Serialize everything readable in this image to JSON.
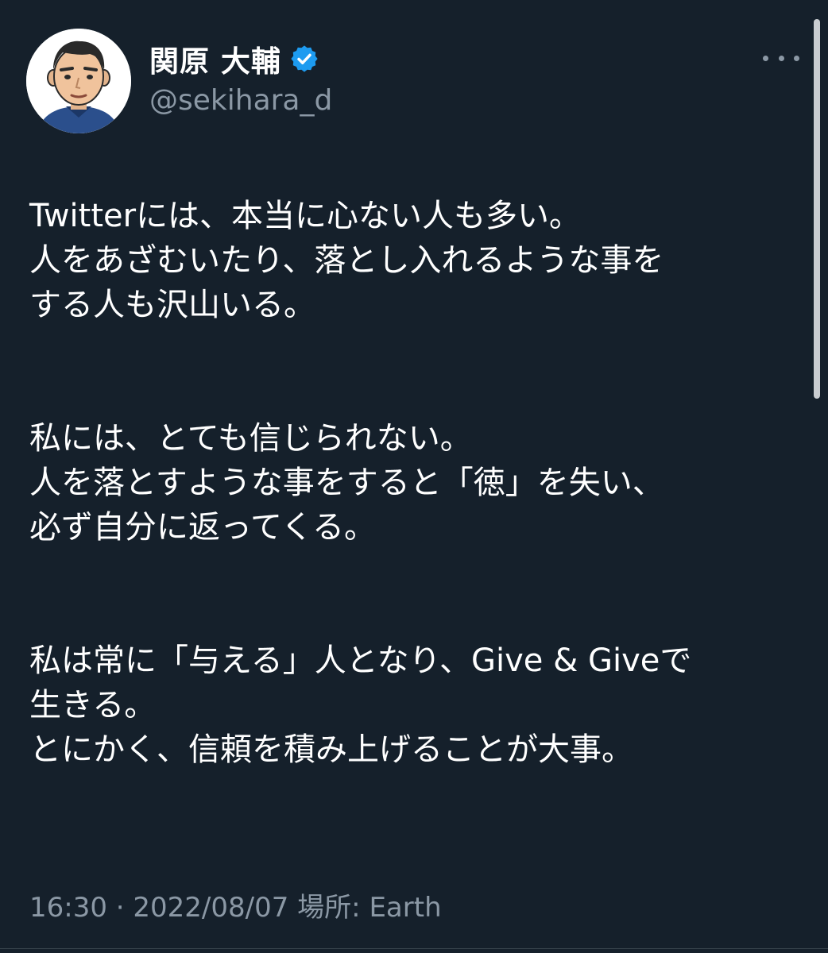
{
  "tweet": {
    "author": {
      "display_name": "関原 大輔",
      "handle": "@sekihara_d",
      "verified": true,
      "avatar_icon": "avatar-icon"
    },
    "more_icon": "more-options-icon",
    "paragraphs": [
      [
        "Twitterには、本当に心ない人も多い。",
        "人をあざむいたり、落とし入れるような事を",
        "する人も沢山いる。"
      ],
      [
        "私には、とても信じられない。",
        "人を落とすような事をすると「徳」を失い、",
        "必ず自分に返ってくる。"
      ],
      [
        "私は常に「与える」人となり、Give & Giveで",
        "生きる。",
        "とにかく、信頼を積み上げることが大事。"
      ]
    ],
    "timestamp": "16:30 · 2022/08/07 場所: Earth"
  },
  "colors": {
    "background": "#15202b",
    "text": "#ffffff",
    "secondary_text": "#8b98a5",
    "verified_badge": "#1d9bf0"
  }
}
